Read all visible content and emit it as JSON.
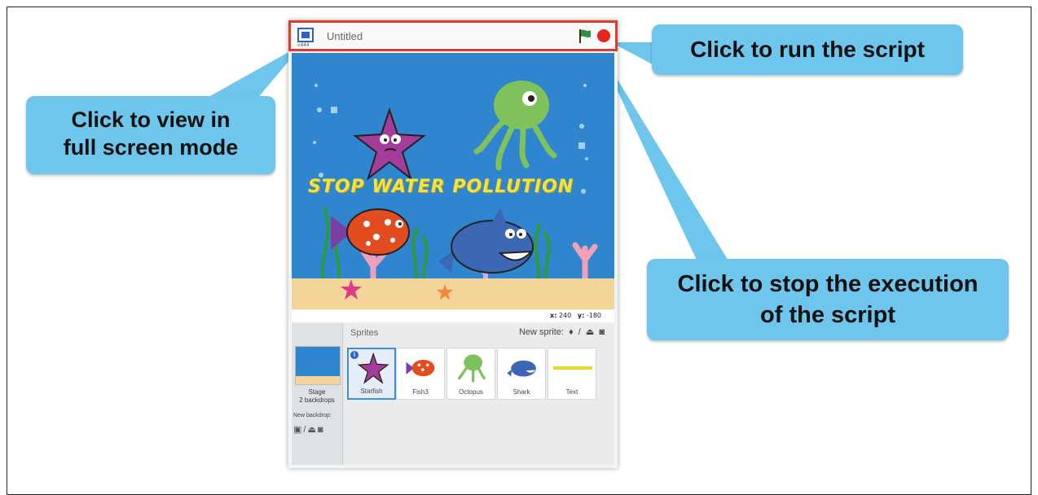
{
  "window": {
    "project_title": "Untitled",
    "fullscreen_caption": "v444"
  },
  "stage": {
    "banner_text": "STOP WATER POLLUTION",
    "x_label": "x:",
    "x_value": "240",
    "y_label": "y:",
    "y_value": "-180"
  },
  "sprite_pane": {
    "sprites_label": "Sprites",
    "new_sprite_label": "New sprite:",
    "stage_label": "Stage",
    "stage_backdrops": "2 backdrops",
    "new_backdrop_label": "New backdrop:",
    "sprites": [
      {
        "name": "Starfish",
        "selected": true
      },
      {
        "name": "Fish3",
        "selected": false
      },
      {
        "name": "Octopus",
        "selected": false
      },
      {
        "name": "Shark",
        "selected": false
      },
      {
        "name": "Text",
        "selected": false
      }
    ]
  },
  "callouts": {
    "fullscreen": "Click to view in full screen mode",
    "fullscreen_line1": "Click to view in",
    "fullscreen_line2": "full screen mode",
    "run": "Click to run the script",
    "stop_line1": "Click to stop the execution",
    "stop_line2": "of the script"
  },
  "colors": {
    "callout_bg": "#6ec6ec",
    "highlight_border": "#e23b2e",
    "stage_water": "#2f86cf",
    "stop_button": "#e5271e",
    "flag": "#2f8f3a"
  },
  "icons": [
    "fullscreen-icon",
    "green-flag-icon",
    "stop-icon",
    "paint-brush-icon",
    "pencil-icon",
    "upload-icon",
    "camera-icon",
    "info-icon"
  ]
}
